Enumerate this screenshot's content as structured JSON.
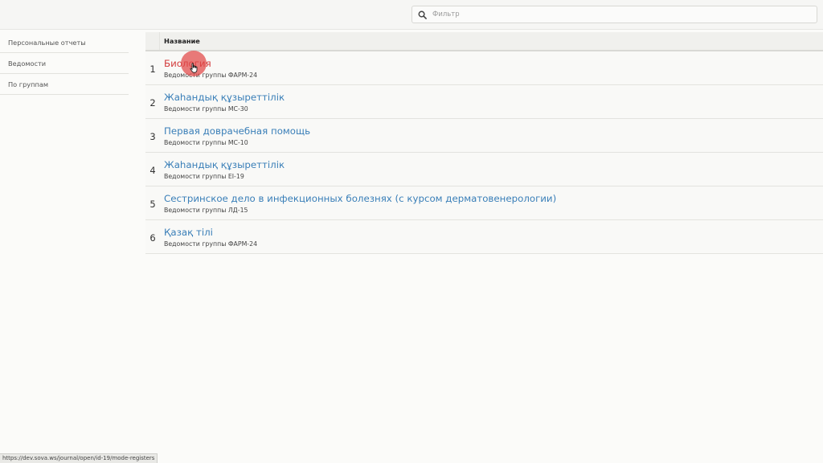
{
  "search": {
    "placeholder": "Фильтр",
    "value": ""
  },
  "sidebar": {
    "items": [
      {
        "label": "Персональные отчеты"
      },
      {
        "label": "Ведомости"
      },
      {
        "label": "По группам"
      }
    ]
  },
  "table": {
    "header": "Название",
    "rows": [
      {
        "num": "1",
        "name": "Биология",
        "sub": "Ведомости группы ФАРМ-24"
      },
      {
        "num": "2",
        "name": "Жаһандық құзыреттілік",
        "sub": "Ведомости группы МС-30"
      },
      {
        "num": "3",
        "name": "Первая доврачебная помощь",
        "sub": "Ведомости группы МС-10"
      },
      {
        "num": "4",
        "name": "Жаһандық құзыреттілік",
        "sub": "Ведомости группы ЕІ-19"
      },
      {
        "num": "5",
        "name": "Сестринское дело в инфекционных болезнях (с курсом дерматовенерологии)",
        "sub": "Ведомости группы ЛД-15"
      },
      {
        "num": "6",
        "name": "Қазақ тілі",
        "sub": "Ведомости группы ФАРМ-24"
      }
    ]
  },
  "statusbar": {
    "url": "https://dev.sova.ws/journal/open/id-19/mode-registers"
  },
  "colors": {
    "link": "#3a7fb8",
    "active_link": "#d23a3a",
    "cursor_highlight": "#e14646"
  }
}
